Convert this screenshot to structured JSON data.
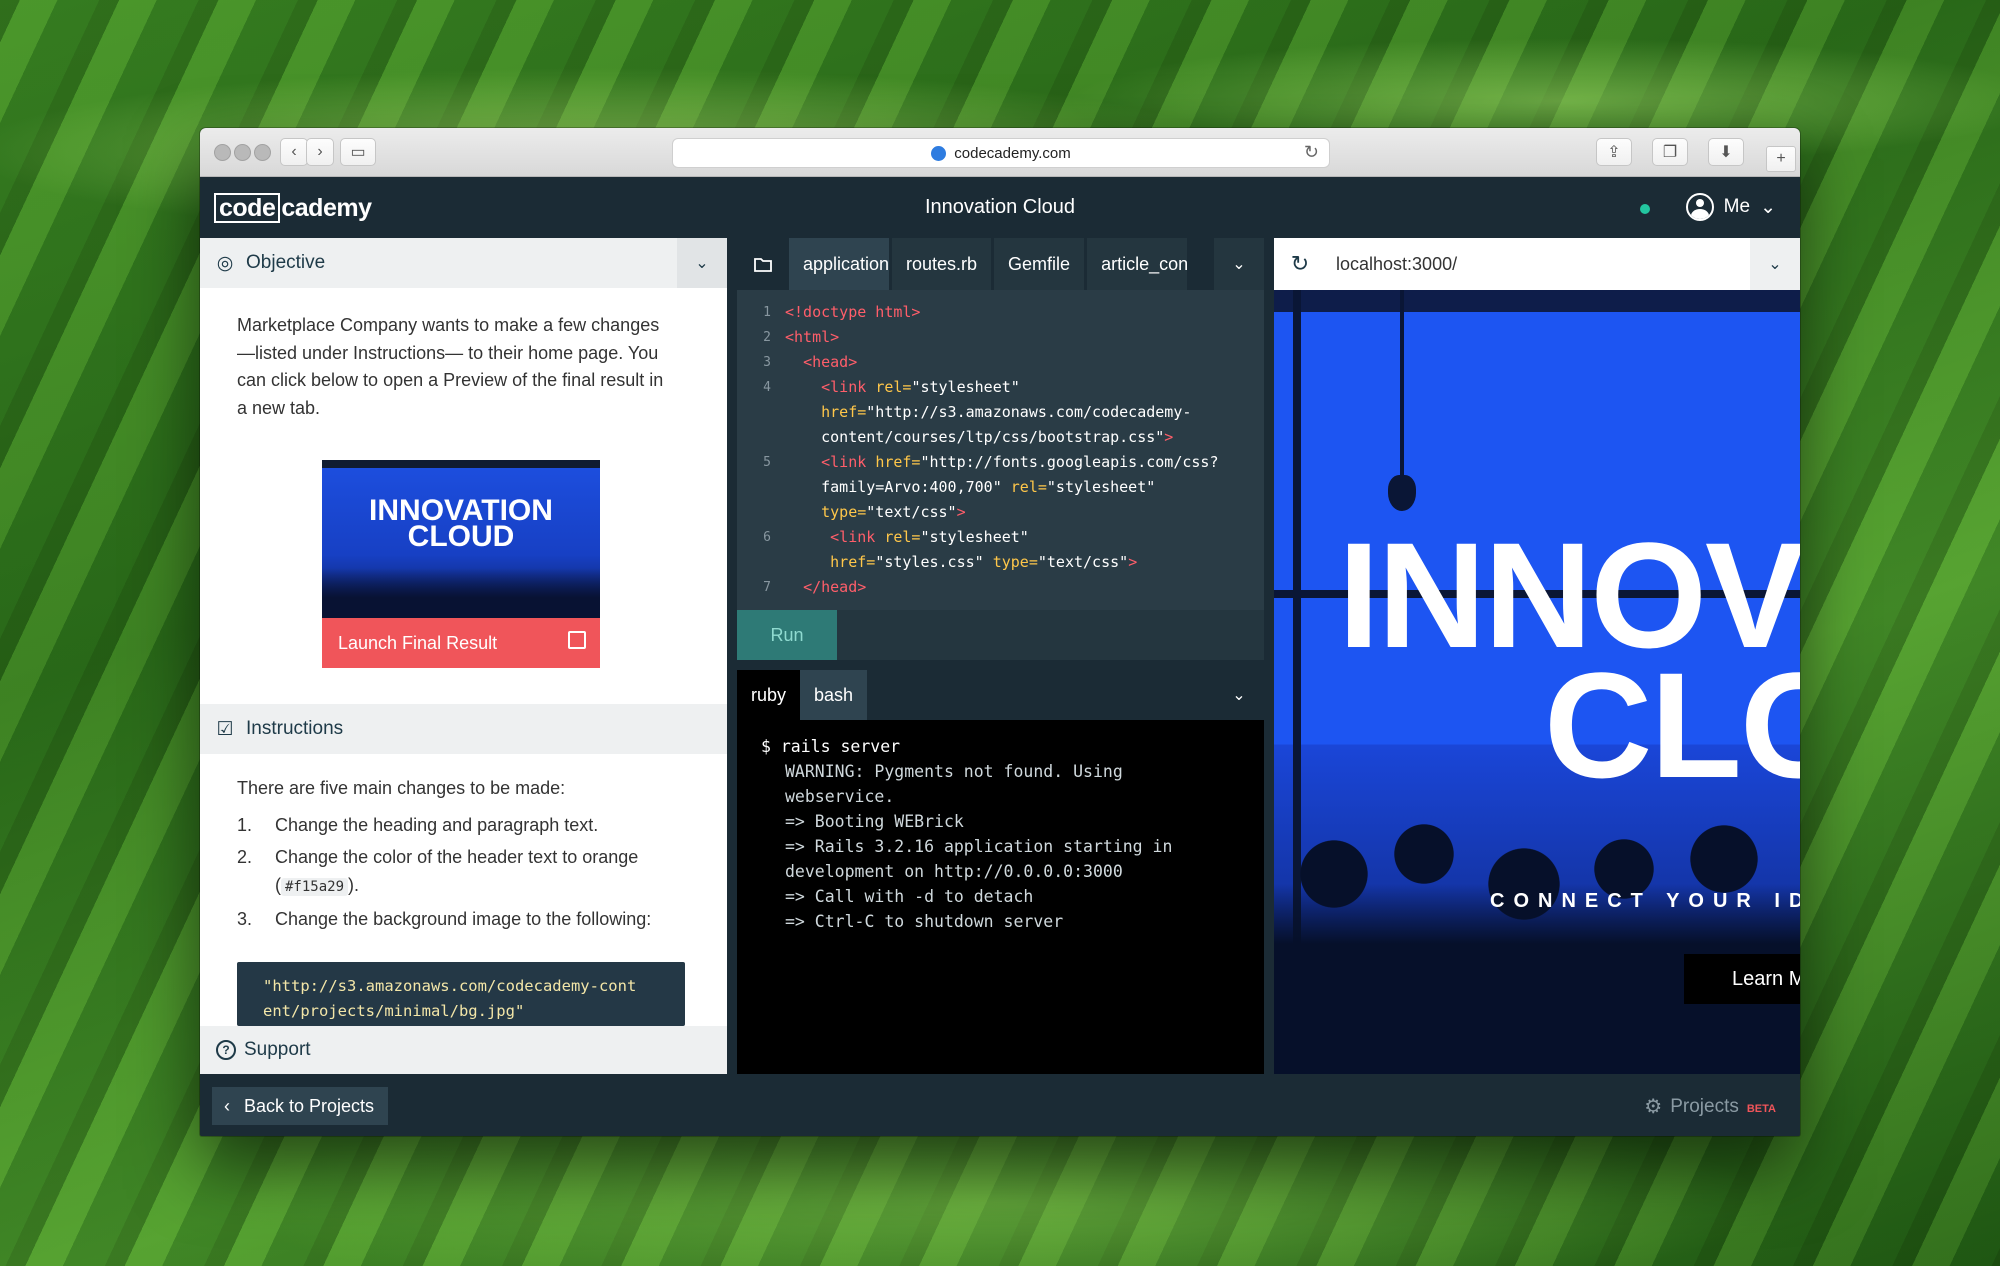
{
  "browser": {
    "url": "codecademy.com"
  },
  "app": {
    "logo_boxed": "code",
    "logo_rest": "cademy",
    "title": "Innovation Cloud",
    "user_label": "Me"
  },
  "objective": {
    "heading": "Objective",
    "text": "Marketplace Company wants to make a few changes—listed under Instructions— to their home page. You can click below to open a Preview of the final result in a new tab.",
    "card_title": "INNOVATION CLOUD",
    "launch_label": "Launch Final Result"
  },
  "instructions": {
    "heading": "Instructions",
    "intro": "There are five main changes to be made:",
    "items": [
      {
        "num": "1.",
        "text": "Change the heading and paragraph text."
      },
      {
        "num": "2.",
        "text_before": "Change the color of the header text to orange (",
        "code": "#f15a29",
        "text_after": ")."
      },
      {
        "num": "3.",
        "text": "Change the background image to the following:"
      }
    ],
    "code_block": "\"http://s3.amazonaws.com/codecademy-cont\nent/projects/minimal/bg.jpg\""
  },
  "support": {
    "label": "Support"
  },
  "editor": {
    "tabs": [
      "application",
      "routes.rb",
      "Gemfile",
      "article_con"
    ],
    "run_label": "Run"
  },
  "terminal": {
    "tabs": [
      "ruby",
      "bash"
    ],
    "prompt": "$ rails server",
    "output": "WARNING: Pygments not found. Using\nwebservice.\n=> Booting WEBrick\n=> Rails 3.2.16 application starting in\ndevelopment on http://0.0.0.0:3000\n=> Call with -d to detach\n=> Ctrl-C to shutdown server"
  },
  "preview": {
    "address": "localhost:3000/",
    "heading_line1": "INNOV",
    "heading_line2": "CLO",
    "tagline": "CONNECT YOUR ID",
    "cta": "Learn M"
  },
  "footer": {
    "back_label": "Back to Projects",
    "projects_label": "Projects",
    "beta_label": "BETA"
  },
  "colors": {
    "app_dark": "#1b2b35",
    "accent_red": "#f0555a",
    "status_green": "#23c6a0",
    "preview_blue": "#1d55f2"
  }
}
